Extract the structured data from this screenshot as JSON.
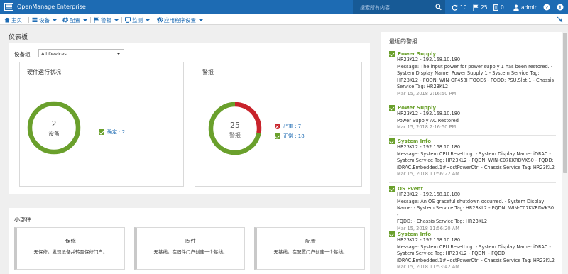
{
  "header": {
    "app_title": "OpenManage Enterprise",
    "search_placeholder": "搜索所有内容",
    "jobs_count": "10",
    "alerts_count": "25",
    "tasks_count": "0",
    "user": "admin"
  },
  "menu": {
    "home": "主页",
    "devices": "设备",
    "configuration": "配置",
    "alerts": "警报",
    "monitor": "监测",
    "app_settings": "应用程序设置"
  },
  "dashboard": {
    "title": "仪表板",
    "group_label": "设备组",
    "group_value": "All Devices"
  },
  "hardware": {
    "title": "硬件运行状况",
    "count": "2",
    "unit": "设备",
    "legend_label": "确定 : 2",
    "ok_fraction": 1.0
  },
  "alerts_card": {
    "title": "警报",
    "count": "25",
    "unit": "警报",
    "critical_label": "严重 : 7",
    "normal_label": "正常 : 18",
    "critical": 7,
    "normal": 18
  },
  "widgets": {
    "title": "小部件",
    "items": [
      {
        "title": "保修",
        "subtitle": "无保修。发现设备并转至保修门户。"
      },
      {
        "title": "固件",
        "subtitle": "无基线。在固件门户创建一个基线。"
      },
      {
        "title": "配置",
        "subtitle": "无基线。在配置门户创建一个基线。"
      }
    ]
  },
  "recent_alerts": {
    "title": "最近的警报",
    "items": [
      {
        "name": "Power Supply",
        "lines": [
          "HR23KL2 - 192.168.10.180",
          "Message: The input power for power supply 1 has been restored. -",
          "System Display Name: Power Supply 1 - System Service Tag:",
          "HR23KL2 - FQDN: WIN-OP458HTOOE6 - FQDD: PSU.Slot.1 - Chassis",
          "Service Tag: HR23KL2"
        ],
        "time": "Mar 15, 2018 2:16:50 PM"
      },
      {
        "name": "Power Supply",
        "lines": [
          "HR23KL2 - 192.168.10.180",
          "Power Supply AC Restored"
        ],
        "time": "Mar 15, 2018 2:16:50 PM"
      },
      {
        "name": "System Info",
        "lines": [
          "HR23KL2 - 192.168.10.180",
          "Message: System CPU Resetting. - System Display Name: iDRAC -",
          "System Service Tag: HR23KL2 - FQDN: WIN-C07KKRDVKS0 - FQDD:",
          "iDRAC.Embedded.1#HostPowerCtrl - Chassis Service Tag: HR23KL2"
        ],
        "time": "Mar 15, 2018 11:56:22 AM"
      },
      {
        "name": "OS Event",
        "lines": [
          "HR23KL2 - 192.168.10.180",
          "Message: An OS graceful shutdown occurred. - System Display",
          "Name: - System Service Tag: HR23KL2 - FQDN: WIN-C07KKRDVKS0 -",
          "FQDD: - Chassis Service Tag: HR23KL2"
        ],
        "time": "Mar 15, 2018 11:56:20 AM"
      },
      {
        "name": "System Info",
        "lines": [
          "HR23KL2 - 192.168.10.180",
          "Message: System CPU Resetting. - System Display Name: iDRAC -",
          "System Service Tag: HR23KL2 - FQDN: - FQDD:",
          "iDRAC.Embedded.1#HostPowerCtrl - Chassis Service Tag: HR23KL2"
        ],
        "time": "Mar 15, 2018 11:53:42 AM"
      }
    ]
  },
  "colors": {
    "brand": "#1d6bb3",
    "ok": "#6aa02c",
    "critical": "#c8232b"
  }
}
